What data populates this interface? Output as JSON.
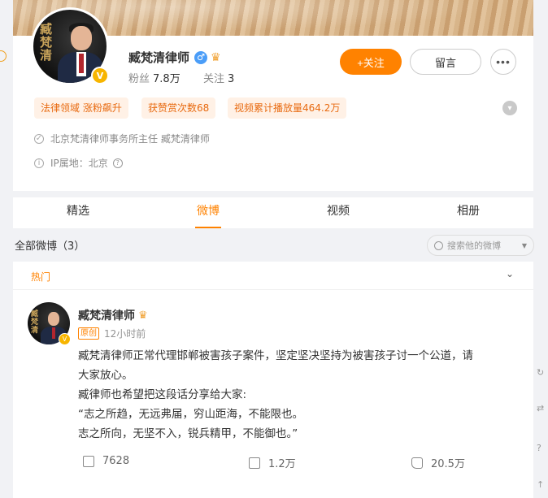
{
  "profile": {
    "name": "臧梵清律师",
    "avatar_calligraphy": "臧梵清",
    "verified_badge": "V",
    "gender_symbol": "♂",
    "fans_label": "粉丝",
    "fans_count": "7.8万",
    "follow_label": "关注",
    "follow_count": "3",
    "follow_button": "+关注",
    "message_button": "留言",
    "more_button": "•••",
    "tags": [
      "法律领域 涨粉飙升",
      "获赞赏次数68",
      "视频累计播放量464.2万"
    ],
    "bio": "北京梵清律师事务所主任 臧梵清律师",
    "ip_location": "IP属地：北京"
  },
  "tabs": [
    {
      "label": "精选"
    },
    {
      "label": "微博",
      "active": true
    },
    {
      "label": "视频"
    },
    {
      "label": "相册"
    }
  ],
  "feed": {
    "all_label": "全部微博（3）",
    "search_placeholder": "搜索他的微博",
    "hot_label": "热门",
    "post": {
      "author": "臧梵清律师",
      "badge": "原创",
      "time": "12小时前",
      "lines": [
        "臧梵清律师正常代理邯郸被害孩子案件，坚定坚决坚持为被害孩子讨一个公道，请",
        "大家放心。",
        "臧律师也希望把这段话分享给大家:",
        "“志之所趋，无远弗届，穷山距海，不能限也。",
        "志之所向，无坚不入，锐兵精甲，不能御也。”"
      ],
      "reposts": "7628",
      "comments": "1.2万",
      "likes": "20.5万"
    }
  },
  "colors": {
    "accent": "#ff8200",
    "tag_bg": "#fff1e6",
    "tag_text": "#e86a10",
    "verified": "#f7b500",
    "page_bg": "#f1f2f5"
  }
}
